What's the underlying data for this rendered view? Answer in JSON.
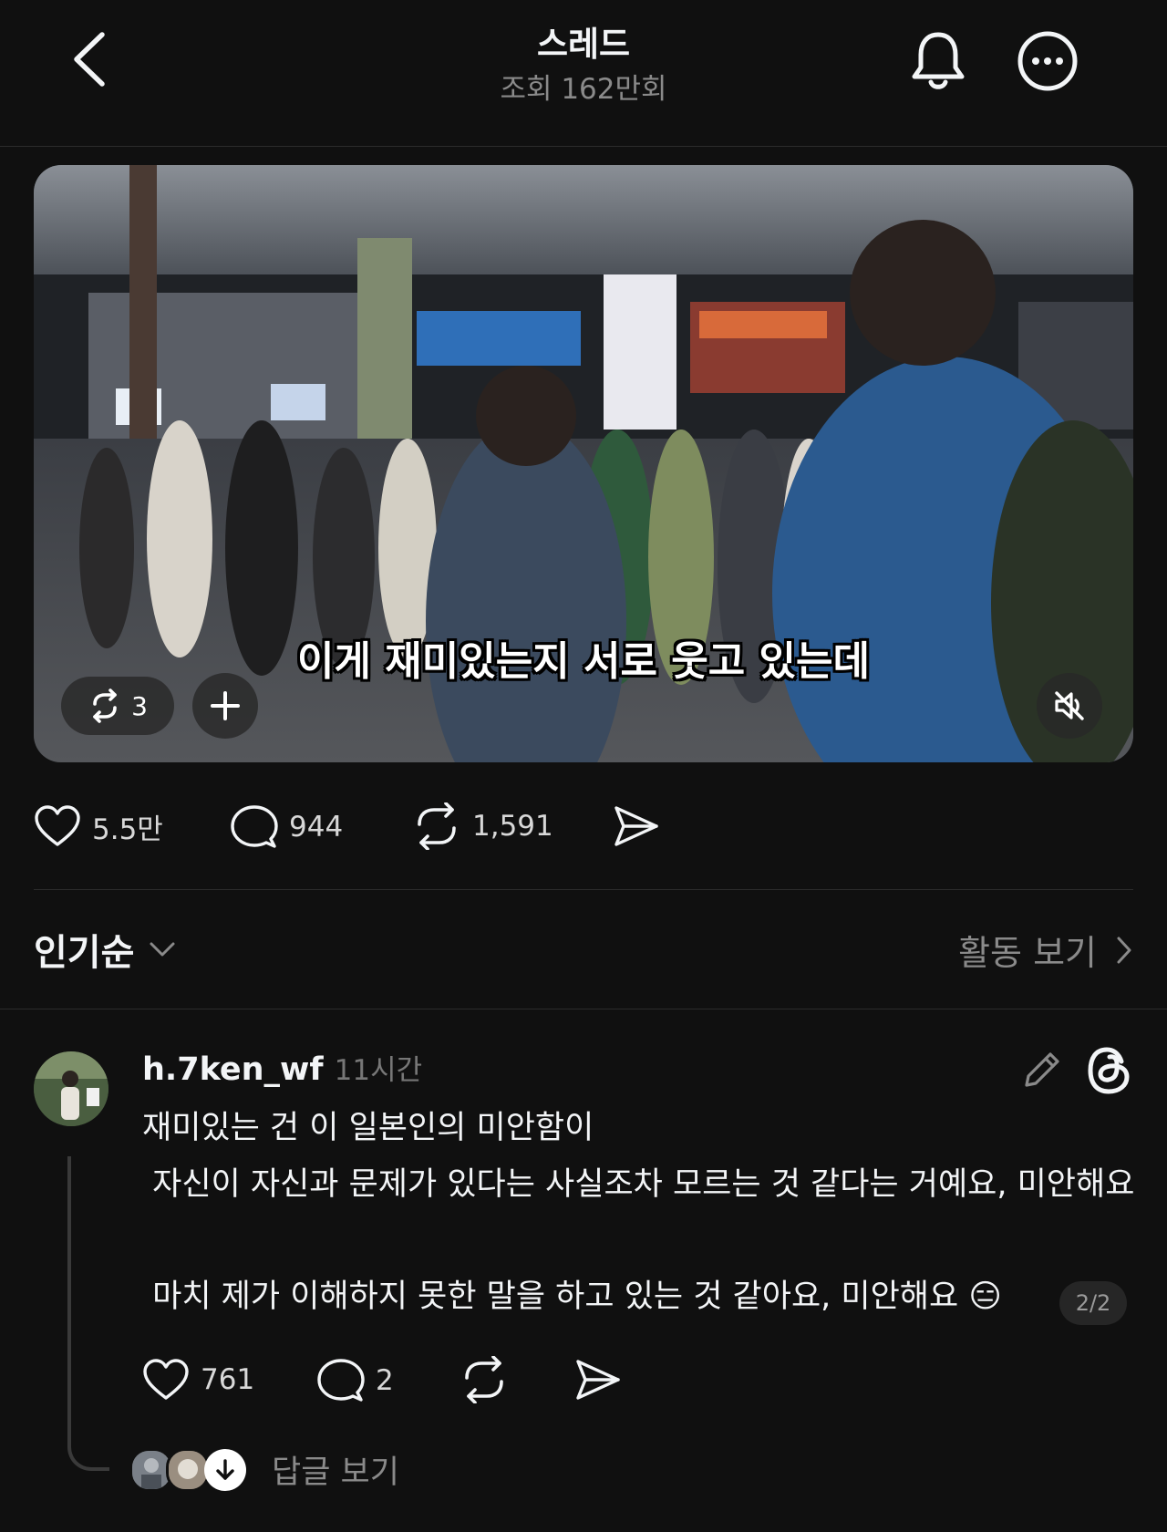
{
  "header": {
    "title": "스레드",
    "views": "조회 162만회",
    "back_icon": "chevron-left-icon",
    "notify_icon": "bell-icon",
    "more_icon": "more-circle-icon"
  },
  "media": {
    "caption": "이게 재미있는지 서로 웃고 있는데",
    "repost_count": "3",
    "mute_icon": "speaker-muted-icon"
  },
  "post_actions": {
    "likes": "5.5만",
    "comments": "944",
    "reposts": "1,591"
  },
  "sort": {
    "label": "인기순",
    "activity_label": "활동 보기"
  },
  "reply": {
    "username": "h.7ken_wf",
    "time": "11시간",
    "lines": [
      "재미있는 건 이 일본인의 미안함이",
      " 자신이 자신과 문제가 있다는 사실조차 모르는 것 같다는 거예요, 미안해요",
      " 마치 제가 이해하지 못한 말을 하고 있는 것 같아요, 미안해요 😑"
    ],
    "page_badge": "2/2",
    "likes": "761",
    "comments": "2",
    "view_replies": "답글 보기"
  },
  "colors": {
    "background": "#101010",
    "text": "#f3f5f7",
    "muted": "#8a8a8a",
    "divider": "#2b2b2b"
  }
}
